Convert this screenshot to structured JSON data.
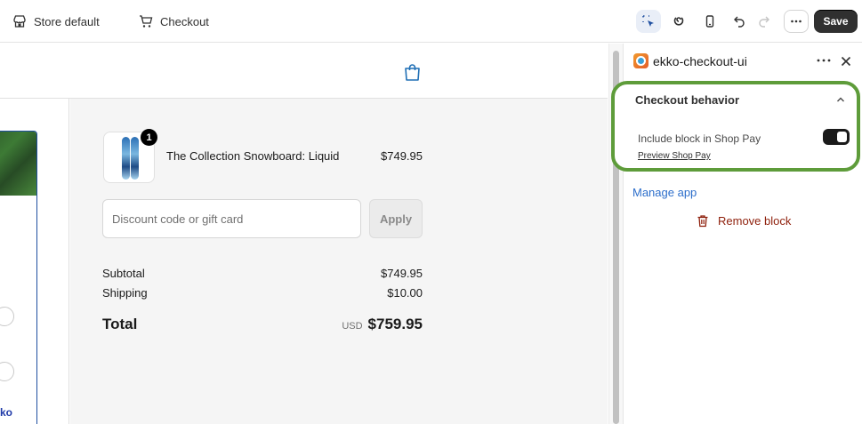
{
  "topbar": {
    "store_label": "Store default",
    "checkout_label": "Checkout",
    "save_label": "Save"
  },
  "order": {
    "product_name": "The Collection Snowboard: Liquid",
    "product_price": "$749.95",
    "quantity": "1",
    "discount_placeholder": "Discount code or gift card",
    "apply_label": "Apply",
    "subtotal_label": "Subtotal",
    "subtotal_value": "$749.95",
    "shipping_label": "Shipping",
    "shipping_value": "$10.00",
    "total_label": "Total",
    "total_currency": "USD",
    "total_value": "$759.95"
  },
  "left_partial": {
    "logo_text": "ko"
  },
  "panel": {
    "app_name": "ekko-checkout-ui",
    "section_title": "Checkout behavior",
    "toggle_label": "Include block in Shop Pay",
    "toggle_on": true,
    "preview_link": "Preview Shop Pay",
    "manage_link": "Manage app",
    "remove_label": "Remove block"
  },
  "colors": {
    "accent_link": "#2c6ecb",
    "danger": "#8e1f0b",
    "highlight_outline": "#5e9c3a",
    "save_bg": "#303030"
  }
}
